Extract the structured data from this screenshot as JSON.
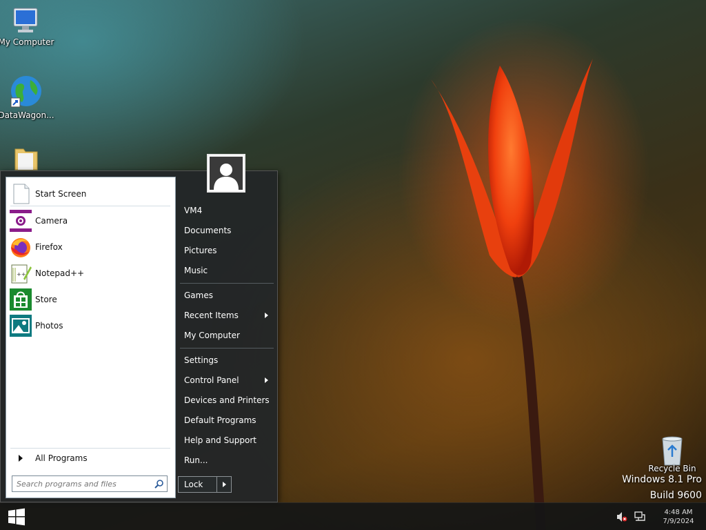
{
  "desktop": {
    "icons": [
      {
        "label": "My Computer",
        "icon": "computer-icon"
      },
      {
        "label": "DataWagon...",
        "icon": "globe-shortcut-icon"
      },
      {
        "label": "",
        "icon": "folder-icon"
      },
      {
        "label": "Recycle Bin",
        "icon": "recycle-bin-icon"
      }
    ]
  },
  "start_menu": {
    "pinned": [
      {
        "label": "Start Screen",
        "icon": "start-screen-icon"
      },
      {
        "label": "Camera",
        "icon": "camera-icon",
        "color": "#8a1c8a"
      },
      {
        "label": "Firefox",
        "icon": "firefox-icon"
      },
      {
        "label": "Notepad++",
        "icon": "notepadpp-icon"
      },
      {
        "label": "Store",
        "icon": "store-icon",
        "color": "#1a8a2e"
      },
      {
        "label": "Photos",
        "icon": "photos-icon",
        "color": "#0e7a80"
      }
    ],
    "all_programs": "All Programs",
    "search_placeholder": "Search programs and files",
    "right_items": {
      "user": "VM4",
      "documents": "Documents",
      "pictures": "Pictures",
      "music": "Music",
      "games": "Games",
      "recent_items": "Recent Items",
      "my_computer": "My Computer",
      "settings": "Settings",
      "control_panel": "Control Panel",
      "devices_printers": "Devices and Printers",
      "default_programs": "Default Programs",
      "help_support": "Help and Support",
      "run": "Run..."
    },
    "lock_label": "Lock"
  },
  "watermark": {
    "line1": "Windows 8.1 Pro",
    "line2": "Build 9600"
  },
  "taskbar": {
    "time": "4:48 AM",
    "date": "7/9/2024",
    "tray_icons": [
      "volume-muted-icon",
      "network-icon"
    ]
  }
}
